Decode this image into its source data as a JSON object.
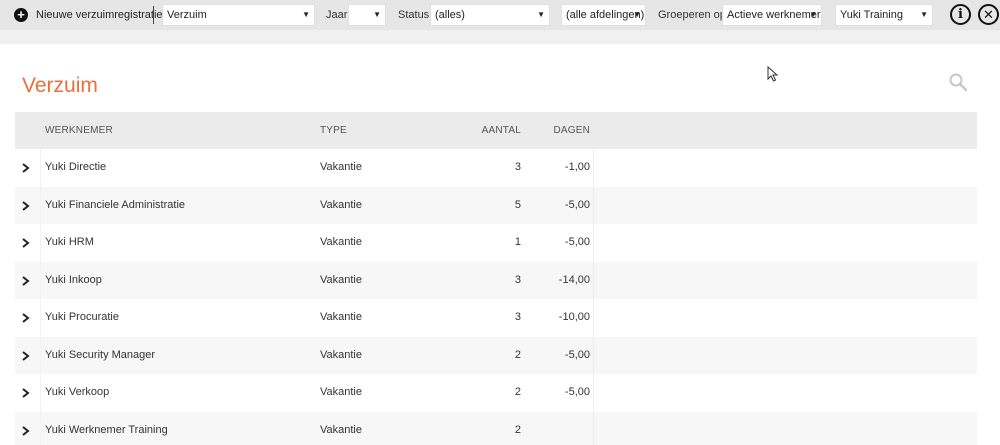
{
  "toolbar": {
    "new_label": "Nieuwe verzuimregistratie",
    "type_value": "Verzuim",
    "year_label": "Jaar:",
    "year_value": "",
    "status_label": "Status:",
    "status_value": "(alles)",
    "department_value": "(alle afdelingen)",
    "group_label": "Groeperen op:",
    "group_value": "Actieve werknemers",
    "company_value": "Yuki Training"
  },
  "page": {
    "title": "Verzuim"
  },
  "table": {
    "headers": {
      "employee": "WERKNEMER",
      "type": "TYPE",
      "count": "AANTAL",
      "days": "DAGEN"
    },
    "rows": [
      {
        "employee": "Yuki Directie",
        "type": "Vakantie",
        "count": "3",
        "days": "-1,00"
      },
      {
        "employee": "Yuki Financiele Administratie",
        "type": "Vakantie",
        "count": "5",
        "days": "-5,00"
      },
      {
        "employee": "Yuki HRM",
        "type": "Vakantie",
        "count": "1",
        "days": "-5,00"
      },
      {
        "employee": "Yuki Inkoop",
        "type": "Vakantie",
        "count": "3",
        "days": "-14,00"
      },
      {
        "employee": "Yuki Procuratie",
        "type": "Vakantie",
        "count": "3",
        "days": "-10,00"
      },
      {
        "employee": "Yuki Security Manager",
        "type": "Vakantie",
        "count": "2",
        "days": "-5,00"
      },
      {
        "employee": "Yuki Verkoop",
        "type": "Vakantie",
        "count": "2",
        "days": "-5,00"
      },
      {
        "employee": "Yuki Werknemer Training",
        "type": "Vakantie",
        "count": "2",
        "days": ""
      }
    ]
  },
  "colors": {
    "accent": "#e8703a",
    "toolbar_bg": "#e6e6e6",
    "header_bg": "#ebebeb"
  }
}
